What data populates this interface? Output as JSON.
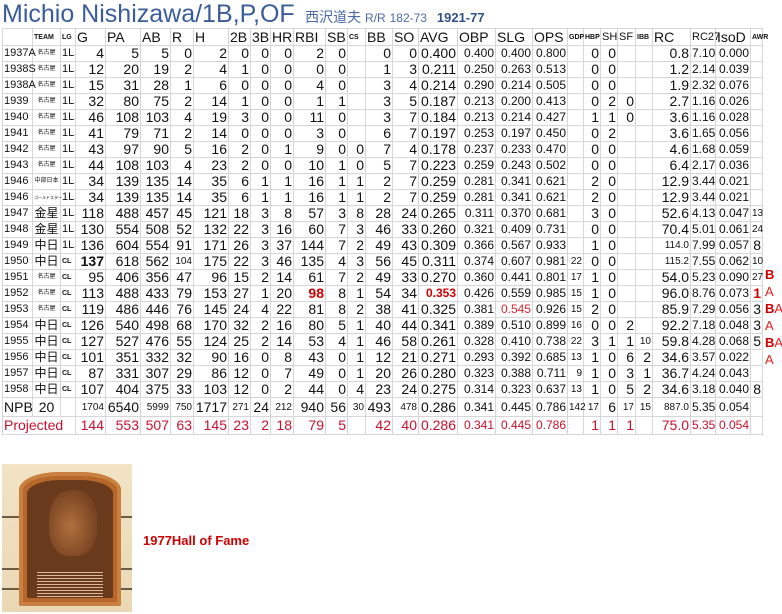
{
  "header": {
    "player_name": "Michio Nishizawa/1B,P,OF",
    "japanese_name": "西沢道夫",
    "bats_throws": "R/R",
    "height_weight": "182-73",
    "lifespan": "1921-77"
  },
  "table": {
    "columns": [
      "",
      "TEAM",
      "LG",
      "G",
      "PA",
      "AB",
      "R",
      "H",
      "2B",
      "3B",
      "HR",
      "RBI",
      "SB",
      "CS",
      "BB",
      "SO",
      "AVG",
      "OBP",
      "SLG",
      "OPS",
      "GDP",
      "HBP",
      "SH",
      "SF",
      "IBB",
      "RC",
      "RC27",
      "IsoD",
      "AWR"
    ],
    "rows": [
      {
        "cells": [
          "1937A",
          "名古屋",
          "1L",
          "4",
          "5",
          "5",
          "0",
          "2",
          "0",
          "0",
          "0",
          "2",
          "0",
          "",
          "0",
          "0",
          "0.400",
          "0.400",
          "0.400",
          "0.800",
          "",
          "0",
          "0",
          "",
          "",
          "0.8",
          "7.10",
          "0.000",
          ""
        ],
        "awards": ""
      },
      {
        "cells": [
          "1938S",
          "名古屋",
          "1L",
          "12",
          "20",
          "19",
          "2",
          "4",
          "1",
          "0",
          "0",
          "0",
          "0",
          "",
          "1",
          "3",
          "0.211",
          "0.250",
          "0.263",
          "0.513",
          "",
          "0",
          "0",
          "",
          "",
          "1.2",
          "2.14",
          "0.039",
          ""
        ],
        "awards": ""
      },
      {
        "cells": [
          "1938A",
          "名古屋",
          "1L",
          "15",
          "31",
          "28",
          "1",
          "6",
          "0",
          "0",
          "0",
          "4",
          "0",
          "",
          "3",
          "4",
          "0.214",
          "0.290",
          "0.214",
          "0.505",
          "",
          "0",
          "0",
          "",
          "",
          "1.9",
          "2.32",
          "0.076",
          ""
        ],
        "awards": ""
      },
      {
        "cells": [
          "1939",
          "名古屋",
          "1L",
          "32",
          "80",
          "75",
          "2",
          "14",
          "1",
          "0",
          "0",
          "1",
          "1",
          "",
          "3",
          "5",
          "0.187",
          "0.213",
          "0.200",
          "0.413",
          "",
          "0",
          "2",
          "0",
          "",
          "2.7",
          "1.16",
          "0.026",
          ""
        ],
        "awards": ""
      },
      {
        "cells": [
          "1940",
          "名古屋",
          "1L",
          "46",
          "108",
          "103",
          "4",
          "19",
          "3",
          "0",
          "0",
          "11",
          "0",
          "",
          "3",
          "7",
          "0.184",
          "0.213",
          "0.214",
          "0.427",
          "",
          "1",
          "1",
          "0",
          "",
          "3.6",
          "1.16",
          "0.028",
          ""
        ],
        "awards": ""
      },
      {
        "cells": [
          "1941",
          "名古屋",
          "1L",
          "41",
          "79",
          "71",
          "2",
          "14",
          "0",
          "0",
          "0",
          "3",
          "0",
          "",
          "6",
          "7",
          "0.197",
          "0.253",
          "0.197",
          "0.450",
          "",
          "0",
          "2",
          "",
          "",
          "3.6",
          "1.65",
          "0.056",
          ""
        ],
        "awards": ""
      },
      {
        "cells": [
          "1942",
          "名古屋",
          "1L",
          "43",
          "97",
          "90",
          "5",
          "16",
          "2",
          "0",
          "1",
          "9",
          "0",
          "0",
          "7",
          "4",
          "0.178",
          "0.237",
          "0.233",
          "0.470",
          "",
          "0",
          "0",
          "",
          "",
          "4.6",
          "1.68",
          "0.059",
          ""
        ],
        "awards": ""
      },
      {
        "cells": [
          "1943",
          "名古屋",
          "1L",
          "44",
          "108",
          "103",
          "4",
          "23",
          "2",
          "0",
          "0",
          "10",
          "1",
          "0",
          "5",
          "7",
          "0.223",
          "0.259",
          "0.243",
          "0.502",
          "",
          "0",
          "0",
          "",
          "",
          "6.4",
          "2.17",
          "0.036",
          ""
        ],
        "awards": ""
      },
      {
        "cells": [
          "1946",
          "中部日本",
          "1L",
          "34",
          "139",
          "135",
          "14",
          "35",
          "6",
          "1",
          "1",
          "16",
          "1",
          "1",
          "2",
          "7",
          "0.259",
          "0.281",
          "0.341",
          "0.621",
          "",
          "2",
          "0",
          "",
          "",
          "12.9",
          "3.44",
          "0.021",
          ""
        ],
        "awards": ""
      },
      {
        "cells": [
          "1946",
          "ゴールドスター",
          "1L",
          "34",
          "139",
          "135",
          "14",
          "35",
          "6",
          "1",
          "1",
          "16",
          "1",
          "1",
          "2",
          "7",
          "0.259",
          "0.281",
          "0.341",
          "0.621",
          "",
          "2",
          "0",
          "",
          "",
          "12.9",
          "3.44",
          "0.021",
          ""
        ],
        "awards": ""
      },
      {
        "cells": [
          "1947",
          "金星",
          "1L",
          "118",
          "488",
          "457",
          "45",
          "121",
          "18",
          "3",
          "8",
          "57",
          "3",
          "8",
          "28",
          "24",
          "0.265",
          "0.311",
          "0.370",
          "0.681",
          "",
          "3",
          "0",
          "",
          "",
          "52.6",
          "4.13",
          "0.047",
          "13"
        ],
        "awards": ""
      },
      {
        "cells": [
          "1948",
          "金星",
          "1L",
          "130",
          "554",
          "508",
          "52",
          "132",
          "22",
          "3",
          "16",
          "60",
          "7",
          "3",
          "46",
          "33",
          "0.260",
          "0.321",
          "0.409",
          "0.731",
          "",
          "0",
          "0",
          "",
          "",
          "70.4",
          "5.01",
          "0.061",
          "24"
        ],
        "awards": ""
      },
      {
        "cells": [
          "1949",
          "中日",
          "1L",
          "136",
          "604",
          "554",
          "91",
          "171",
          "26",
          "3",
          "37",
          "144",
          "7",
          "2",
          "49",
          "43",
          "0.309",
          "0.366",
          "0.567",
          "0.933",
          "",
          "1",
          "0",
          "",
          "",
          "114.0",
          "7.99",
          "0.057",
          "8"
        ],
        "awards": ""
      },
      {
        "cells": [
          "1950",
          "中日",
          "CL",
          "137",
          "618",
          "562",
          "104",
          "175",
          "22",
          "3",
          "46",
          "135",
          "4",
          "3",
          "56",
          "45",
          "0.311",
          "0.374",
          "0.607",
          "0.981",
          "22",
          "0",
          "0",
          "",
          "",
          "115.2",
          "7.55",
          "0.062",
          "10"
        ],
        "awards": "B"
      },
      {
        "cells": [
          "1951",
          "名古屋",
          "CL",
          "95",
          "406",
          "356",
          "47",
          "96",
          "15",
          "2",
          "14",
          "61",
          "7",
          "2",
          "49",
          "33",
          "0.270",
          "0.360",
          "0.441",
          "0.801",
          "17",
          "1",
          "0",
          "",
          "",
          "54.0",
          "5.23",
          "0.090",
          "27"
        ],
        "awards": "A"
      },
      {
        "cells": [
          "1952",
          "名古屋",
          "CL",
          "113",
          "488",
          "433",
          "79",
          "153",
          "27",
          "1",
          "20",
          "98",
          "8",
          "1",
          "54",
          "34",
          "0.353",
          "0.426",
          "0.559",
          "0.985",
          "15",
          "1",
          "0",
          "",
          "",
          "96.0",
          "8.76",
          "0.073",
          "1"
        ],
        "awards": "BA"
      },
      {
        "cells": [
          "1953",
          "名古屋",
          "CL",
          "119",
          "486",
          "446",
          "76",
          "145",
          "24",
          "4",
          "22",
          "81",
          "8",
          "2",
          "38",
          "41",
          "0.325",
          "0.381",
          "0.545",
          "0.926",
          "15",
          "2",
          "0",
          "",
          "",
          "85.9",
          "7.29",
          "0.056",
          "3"
        ],
        "awards": "A"
      },
      {
        "cells": [
          "1954",
          "中日",
          "CL",
          "126",
          "540",
          "498",
          "68",
          "170",
          "32",
          "2",
          "16",
          "80",
          "5",
          "1",
          "40",
          "44",
          "0.341",
          "0.389",
          "0.510",
          "0.899",
          "16",
          "0",
          "0",
          "2",
          "",
          "92.2",
          "7.18",
          "0.048",
          "3"
        ],
        "awards": "BA"
      },
      {
        "cells": [
          "1955",
          "中日",
          "CL",
          "127",
          "527",
          "476",
          "55",
          "124",
          "25",
          "2",
          "14",
          "53",
          "4",
          "1",
          "46",
          "58",
          "0.261",
          "0.328",
          "0.410",
          "0.738",
          "22",
          "3",
          "1",
          "1",
          "10",
          "59.8",
          "4.28",
          "0.068",
          "5"
        ],
        "awards": "A"
      },
      {
        "cells": [
          "1956",
          "中日",
          "CL",
          "101",
          "351",
          "332",
          "32",
          "90",
          "16",
          "0",
          "8",
          "43",
          "0",
          "1",
          "12",
          "21",
          "0.271",
          "0.293",
          "0.392",
          "0.685",
          "13",
          "1",
          "0",
          "6",
          "2",
          "34.6",
          "3.57",
          "0.022",
          ""
        ],
        "awards": ""
      },
      {
        "cells": [
          "1957",
          "中日",
          "CL",
          "87",
          "331",
          "307",
          "29",
          "86",
          "12",
          "0",
          "7",
          "49",
          "0",
          "1",
          "20",
          "26",
          "0.280",
          "0.323",
          "0.388",
          "0.711",
          "9",
          "1",
          "0",
          "3",
          "1",
          "36.7",
          "4.24",
          "0.043",
          ""
        ],
        "awards": ""
      },
      {
        "cells": [
          "1958",
          "中日",
          "CL",
          "107",
          "404",
          "375",
          "33",
          "103",
          "12",
          "0",
          "2",
          "44",
          "0",
          "4",
          "23",
          "24",
          "0.275",
          "0.314",
          "0.323",
          "0.637",
          "13",
          "1",
          "0",
          "5",
          "2",
          "34.6",
          "3.18",
          "0.040",
          "8"
        ],
        "awards": ""
      }
    ],
    "emphasis": [
      {
        "season_index": 13,
        "column": "G",
        "type": "bold"
      },
      {
        "season_index": 15,
        "column": "RBI",
        "type": "league-leader-red-bold"
      },
      {
        "season_index": 15,
        "column": "AVG",
        "type": "league-leader-red-bold"
      },
      {
        "season_index": 15,
        "column": "AWR",
        "type": "league-leader-red-bold"
      },
      {
        "season_index": 16,
        "column": "SLG",
        "type": "red"
      }
    ],
    "totals": {
      "label": "NPB",
      "seasons": "20",
      "cells": [
        "1704",
        "6540",
        "5999",
        "750",
        "1717",
        "271",
        "24",
        "212",
        "940",
        "56",
        "30",
        "493",
        "478",
        "0.286",
        "0.341",
        "0.445",
        "0.786",
        "142",
        "17",
        "6",
        "17",
        "15",
        "887.0",
        "5.35",
        "0.054",
        ""
      ]
    },
    "projected": {
      "label": "Projected",
      "cells": [
        "144",
        "553",
        "507",
        "63",
        "145",
        "23",
        "2",
        "18",
        "79",
        "5",
        "",
        "42",
        "40",
        "0.286",
        "0.341",
        "0.445",
        "0.786",
        "",
        "1",
        "1",
        "1",
        "",
        "75.0",
        "5.35",
        "0.054",
        ""
      ]
    }
  },
  "hall_of_fame": {
    "text": "1977Hall of Fame"
  },
  "colors": {
    "title": "#3a5d9a",
    "highlight_red": "#cc0000",
    "projected_red": "#c8102e",
    "grid": "#dcdcdc"
  }
}
